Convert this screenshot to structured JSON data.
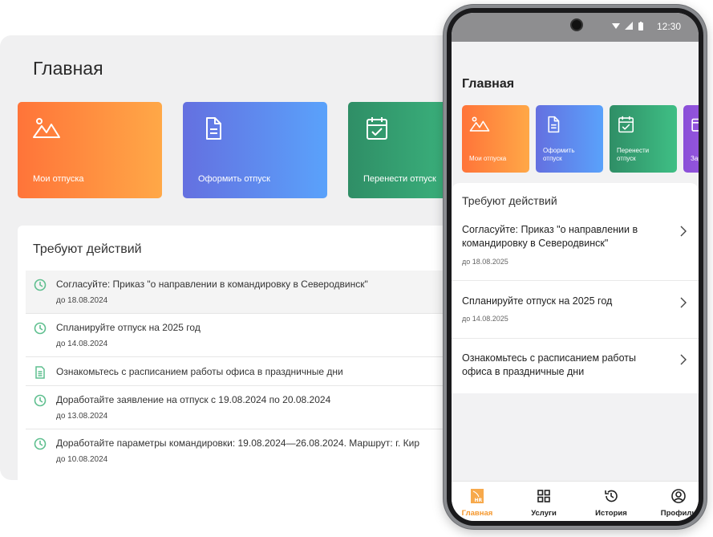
{
  "desktop": {
    "title": "Главная",
    "cards": [
      {
        "label": "Мои отпуска",
        "icon": "mountain-icon"
      },
      {
        "label": "Оформить отпуск",
        "icon": "document-icon"
      },
      {
        "label": "Перенести отпуск",
        "icon": "calendar-check-icon"
      }
    ],
    "actions_title": "Требуют действий",
    "actions": [
      {
        "text": "Согласуйте: Приказ \"о направлении в командировку в Северодвинск\"",
        "date": "до 18.08.2024",
        "icon": "clock-icon"
      },
      {
        "text": "Спланируйте отпуск на 2025 год",
        "date": "до 14.08.2024",
        "icon": "clock-icon"
      },
      {
        "text": "Ознакомьтесь с расписанием работы офиса в праздничные дни",
        "date": "",
        "icon": "document-icon"
      },
      {
        "text": "Доработайте заявление на отпуск с 19.08.2024 по 20.08.2024",
        "date": "до 13.08.2024",
        "icon": "clock-icon"
      },
      {
        "text": "Доработайте параметры командировки: 19.08.2024—26.08.2024. Маршрут: г. Кир",
        "date": "до 10.08.2024",
        "icon": "clock-icon"
      }
    ]
  },
  "mobile": {
    "status_time": "12:30",
    "title": "Главная",
    "cards": [
      {
        "label_l1": "Мои отпуска",
        "label_l2": "",
        "icon": "mountain-icon"
      },
      {
        "label_l1": "Оформить",
        "label_l2": "отпуск",
        "icon": "document-icon"
      },
      {
        "label_l1": "Перенести",
        "label_l2": "отпуск",
        "icon": "calendar-check-icon"
      },
      {
        "label_l1": "Зар",
        "label_l2": "",
        "icon": "card-icon"
      }
    ],
    "actions_title": "Требуют действий",
    "actions": [
      {
        "text": "Согласуйте: Приказ \"о направлении в командировку в Северодвинск\"",
        "date": "до 18.08.2025"
      },
      {
        "text": "Спланируйте отпуск на 2025 год",
        "date": "до 14.08.2025"
      },
      {
        "text": "Ознакомьтесь с расписанием работы офиса в праздничные дни",
        "date": ""
      }
    ],
    "tabs": [
      {
        "label": "Главная",
        "icon": "hr-logo-icon"
      },
      {
        "label": "Услуги",
        "icon": "grid-icon"
      },
      {
        "label": "История",
        "icon": "history-icon"
      },
      {
        "label": "Профиль",
        "icon": "profile-icon"
      }
    ]
  },
  "colors": {
    "accent": "#f5982e",
    "clock_icon": "#5fbf8f",
    "orange_card": "#ff8a3d",
    "blue_card": "#5f8bef",
    "green_card": "#38a877"
  }
}
